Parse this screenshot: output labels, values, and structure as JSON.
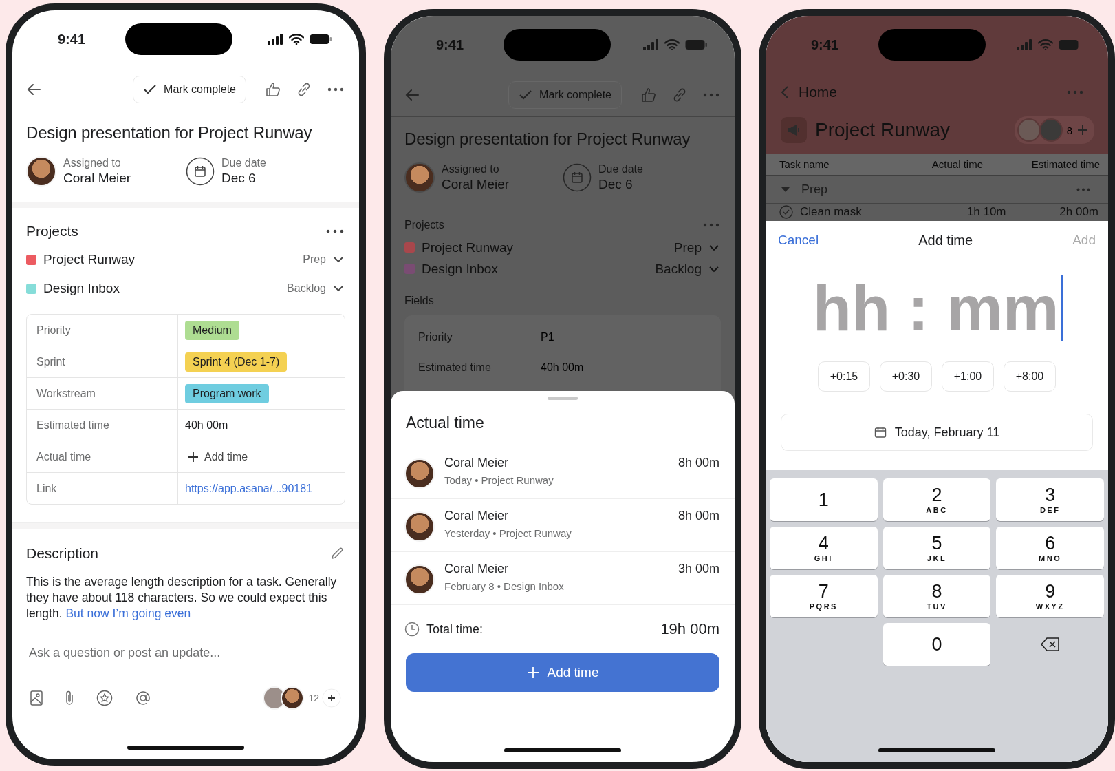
{
  "task_screen": {
    "time": "9:41",
    "mark_complete": "Mark complete",
    "title": "Design presentation for Project Runway",
    "assignee_label": "Assigned to",
    "assignee": "Coral Meier",
    "due_label": "Due date",
    "due": "Dec 6",
    "projects_heading": "Projects",
    "projects": [
      {
        "name": "Project Runway",
        "section": "Prep",
        "color": "#ec5b61"
      },
      {
        "name": "Design Inbox",
        "section": "Backlog",
        "color": "#86ddd9"
      }
    ],
    "fields": [
      {
        "label": "Priority",
        "kind": "tag",
        "value": "Medium",
        "color": "#aedd92"
      },
      {
        "label": "Sprint",
        "kind": "tag",
        "value": "Sprint 4 (Dec 1-7)",
        "color": "#f4d152"
      },
      {
        "label": "Workstream",
        "kind": "tag",
        "value": "Program work",
        "color": "#6fcde0"
      },
      {
        "label": "Estimated time",
        "kind": "text",
        "value": "40h 00m"
      },
      {
        "label": "Actual time",
        "kind": "action",
        "value": "Add time"
      },
      {
        "label": "Link",
        "kind": "link",
        "value": "https://app.asana/...90181"
      }
    ],
    "description_heading": "Description",
    "description": "This is the average length description for a task. Generally they have about 118 characters. So we could expect this length.",
    "description_link": "But now I’m going even",
    "comment_placeholder": "Ask a question or post an update...",
    "follower_count": "12"
  },
  "actual_time_screen": {
    "time": "9:41",
    "mark_complete": "Mark complete",
    "title": "Design presentation for Project Runway",
    "assignee_label": "Assigned to",
    "assignee": "Coral Meier",
    "due_label": "Due date",
    "due": "Dec 6",
    "projects_heading": "Projects",
    "projects": [
      {
        "name": "Project Runway",
        "section": "Prep",
        "color": "#a8474c"
      },
      {
        "name": "Design Inbox",
        "section": "Backlog",
        "color": "#7a4c73"
      }
    ],
    "fields_heading": "Fields",
    "fields": [
      {
        "label": "Priority",
        "value": "P1"
      },
      {
        "label": "Estimated time",
        "value": "40h 00m"
      }
    ],
    "sheet": {
      "title": "Actual time",
      "entries": [
        {
          "name": "Coral Meier",
          "meta": "Today • Project Runway",
          "duration": "8h 00m"
        },
        {
          "name": "Coral Meier",
          "meta": "Yesterday • Project Runway",
          "duration": "8h 00m"
        },
        {
          "name": "Coral Meier",
          "meta": "February 8 • Design Inbox",
          "duration": "3h 00m"
        }
      ],
      "total_label": "Total time:",
      "total": "19h 00m",
      "button": "Add time"
    }
  },
  "add_time_screen": {
    "time": "9:41",
    "back": "Home",
    "project": "Project Runway",
    "member_count": "8",
    "columns": [
      "Task name",
      "Actual time",
      "Estimated time"
    ],
    "section": {
      "name": "Prep",
      "expanded": true
    },
    "rows": [
      {
        "name": "Clean mask",
        "actual": "1h 10m",
        "estimated": "2h 00m"
      }
    ],
    "sheet": {
      "cancel": "Cancel",
      "title": "Add time",
      "add": "Add",
      "add_disabled": true,
      "placeholder": "hh : mm",
      "quick": [
        "+0:15",
        "+0:30",
        "+1:00",
        "+8:00"
      ],
      "date": "Today, February 11",
      "keys": [
        {
          "digit": "1"
        },
        {
          "digit": "2",
          "letters": "ABC"
        },
        {
          "digit": "3",
          "letters": "DEF"
        },
        {
          "digit": "4",
          "letters": "GHI"
        },
        {
          "digit": "5",
          "letters": "JKL"
        },
        {
          "digit": "6",
          "letters": "MNO"
        },
        {
          "digit": "7",
          "letters": "PQRS"
        },
        {
          "digit": "8",
          "letters": "TUV"
        },
        {
          "digit": "9",
          "letters": "WXYZ"
        },
        {
          "digit": "0"
        }
      ]
    }
  }
}
